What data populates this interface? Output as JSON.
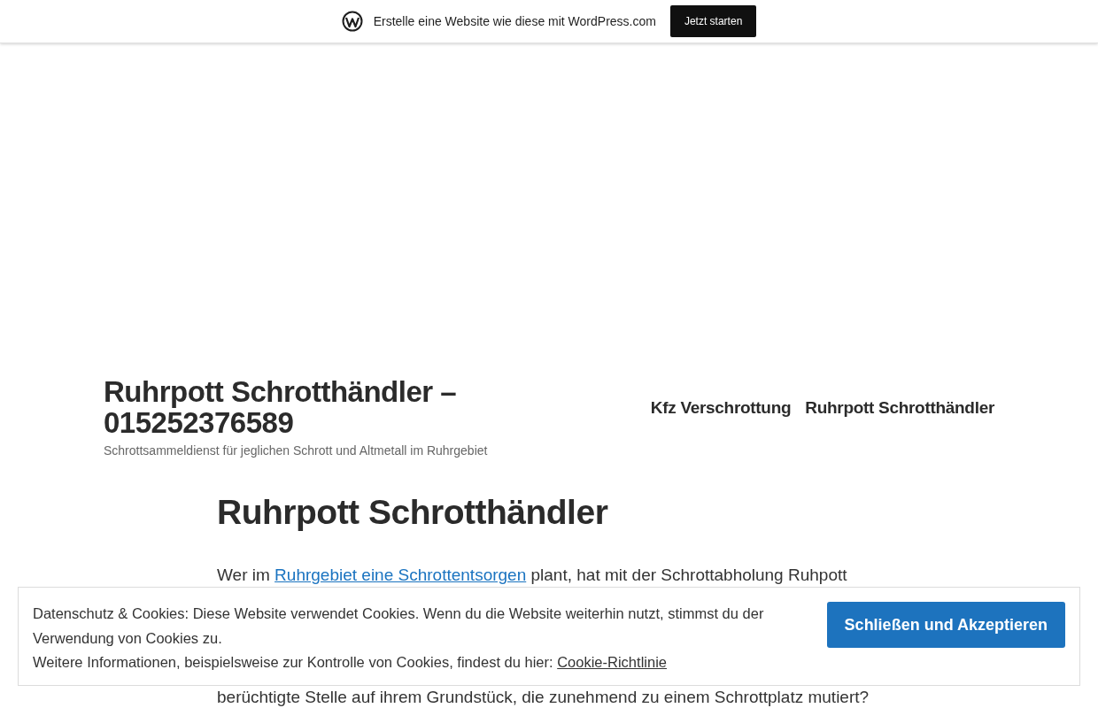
{
  "admin_bar": {
    "message": "Erstelle eine Website wie diese mit WordPress.com",
    "button": "Jetzt starten"
  },
  "header": {
    "site_title": "Ruhrpott Schrotthändler – 015252376589",
    "tagline": "Schrottsammeldienst für jeglichen Schrott und Altmetall im Ruhrgebiet",
    "nav": [
      {
        "label": "Kfz Verschrottung"
      },
      {
        "label": "Ruhrpott Schrotthändler"
      }
    ]
  },
  "page": {
    "title": "Ruhrpott Schrotthändler",
    "lines": [
      {
        "parts": [
          {
            "kind": "text",
            "text": "Wer im "
          },
          {
            "kind": "link",
            "text": "Ruhrgebiet eine Schrottentsorgen"
          },
          {
            "kind": "text",
            "text": " plant, hat mit der Schrottabholung Ruhpott"
          }
        ]
      },
      {
        "parts": [
          {
            "kind": "text",
            "text": "berüchtigte Stelle auf ihrem Grundstück, die zunehmend zu einem Schrottplatz mutiert?"
          }
        ]
      }
    ]
  },
  "cookie_banner": {
    "text": "Datenschutz & Cookies: Diese Website verwendet Cookies. Wenn du die Website weiterhin nutzt, stimmst du der Verwendung von Cookies zu.",
    "more": "Weitere Informationen, beispielsweise zur Kontrolle von Cookies, findest du hier:",
    "link": "Cookie-Richtlinie",
    "button": "Schließen und Akzeptieren"
  }
}
